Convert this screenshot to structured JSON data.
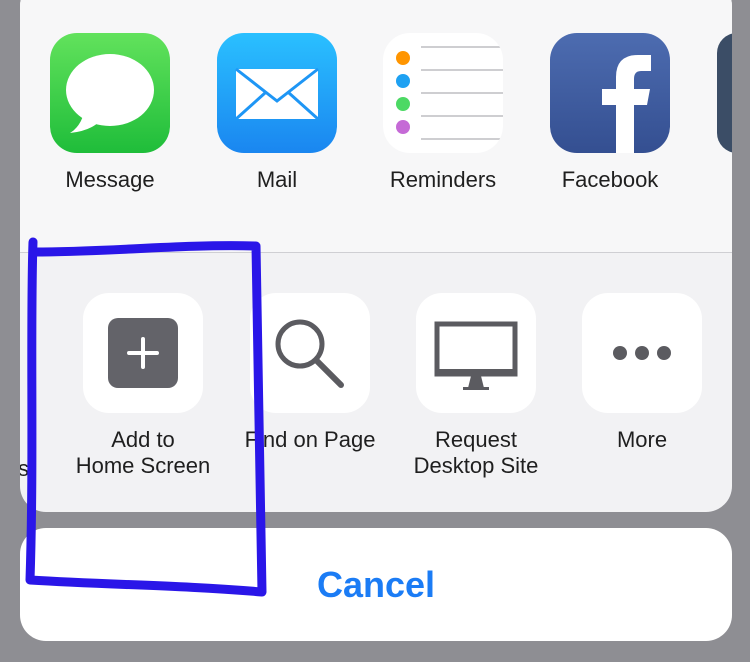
{
  "share_sheet": {
    "apps": [
      {
        "label": "Message",
        "icon": "message-icon"
      },
      {
        "label": "Mail",
        "icon": "mail-icon"
      },
      {
        "label": "Reminders",
        "icon": "reminders-icon"
      },
      {
        "label": "Facebook",
        "icon": "facebook-icon"
      }
    ],
    "actions": [
      {
        "line1": "Add to",
        "line2": "Home Screen",
        "icon": "plus-square-icon"
      },
      {
        "line1": "Find on Page",
        "line2": "",
        "icon": "magnifier-icon"
      },
      {
        "line1": "Request",
        "line2": "Desktop Site",
        "icon": "desktop-icon"
      },
      {
        "line1": "More",
        "line2": "",
        "icon": "ellipsis-icon"
      }
    ],
    "partial_left_label": "st"
  },
  "cancel_label": "Cancel",
  "colors": {
    "message_green": "#34c759",
    "mail_blue": "#1ea1f2",
    "facebook_blue": "#3b5998",
    "cancel_blue": "#1b7cf5",
    "annotation": "#2a16e8"
  }
}
